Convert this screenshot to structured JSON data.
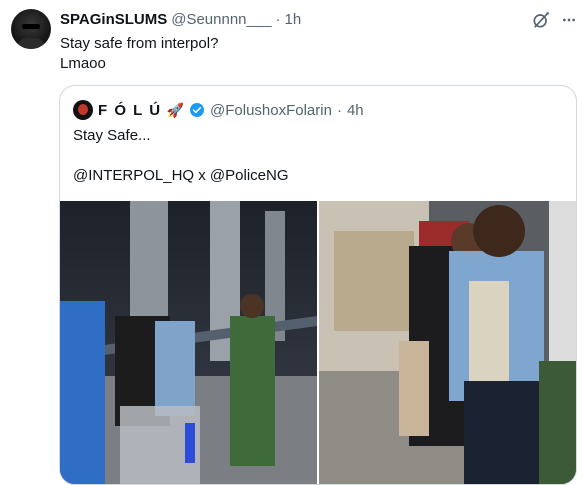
{
  "tweet": {
    "author": {
      "display_name": "SPAGinSLUMS",
      "handle": "@Seunnnn___",
      "separator": "·",
      "time": "1h"
    },
    "lines": [
      "Stay safe from interpol?",
      "Lmaoo"
    ],
    "icons": [
      "grok-icon",
      "more-icon"
    ]
  },
  "quote": {
    "author": {
      "display_name": "F Ó L Ú",
      "emoji": "🚀",
      "handle": "@FolushoxFolarin",
      "separator": "·",
      "time": "4h"
    },
    "text": "Stay Safe...\n\n@INTERPOL_HQ x @PoliceNG",
    "photos": [
      {
        "name": "photo-airport-arrest-left"
      },
      {
        "name": "photo-airport-arrest-right"
      }
    ]
  },
  "colors": {
    "text": "#0f1419",
    "secondary": "#536471",
    "border": "#cfd9de",
    "verified": "#1d9bf0"
  }
}
